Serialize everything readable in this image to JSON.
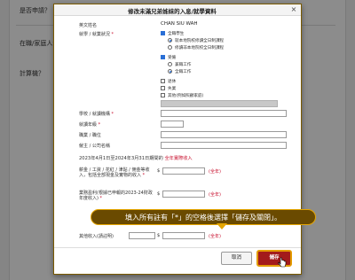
{
  "background": {
    "lines": [
      "是否申請？",
      "在職/家庭人士是否曾申請？",
      "計算機？"
    ]
  },
  "modal": {
    "title": "修改未滿兄弟姊妹的入息/就學資料",
    "close_label": "×",
    "english_name_label": "英文姓名",
    "english_name_value": "CHAN SIU WAH",
    "study_status_label": "就學 / 就業狀況",
    "required_mark": "*",
    "options": {
      "full_time_student": "全職學生",
      "local_institution": "就本地院校修讀全日制課程",
      "non_local_institution": "修讀非本地院校全日制課程",
      "employed": "受僱",
      "part_time": "兼職工作",
      "full_time_work": "全職工作",
      "retired": "退休",
      "unemployed": "失業",
      "other": "其他(例如照顧家庭)"
    },
    "school_label": "學校 / 就讀機構",
    "grade_label": "就讀年級",
    "occupation_label": "職業 / 職位",
    "employer_label": "僱主 / 公司名稱",
    "period_text": "2023年4月1日至2024年3月31日期間的",
    "period_highlight": "全年實際收入",
    "income_salary_label": "薪金 / 工資 / 花紅 / 津貼 / 佣金等收入，包括全部現金及實物的收入",
    "income_self_employed_label": "業務盈利(根據已申報的2023-24財政年度收入)",
    "income_other_label": "其他收入(請註明)",
    "dollar_sign": "$",
    "annual_tag": "(全年)",
    "cancel_label": "取消",
    "save_label": "儲存"
  },
  "tooltip": {
    "text": "填入所有註有「*」的空格後選擇「儲存及關閉」。"
  },
  "colors": {
    "accent_red": "#a31b1b",
    "highlight_border": "#e39b00",
    "tooltip_bg": "#6a4a00",
    "checkbox_blue": "#2a6fd6"
  }
}
